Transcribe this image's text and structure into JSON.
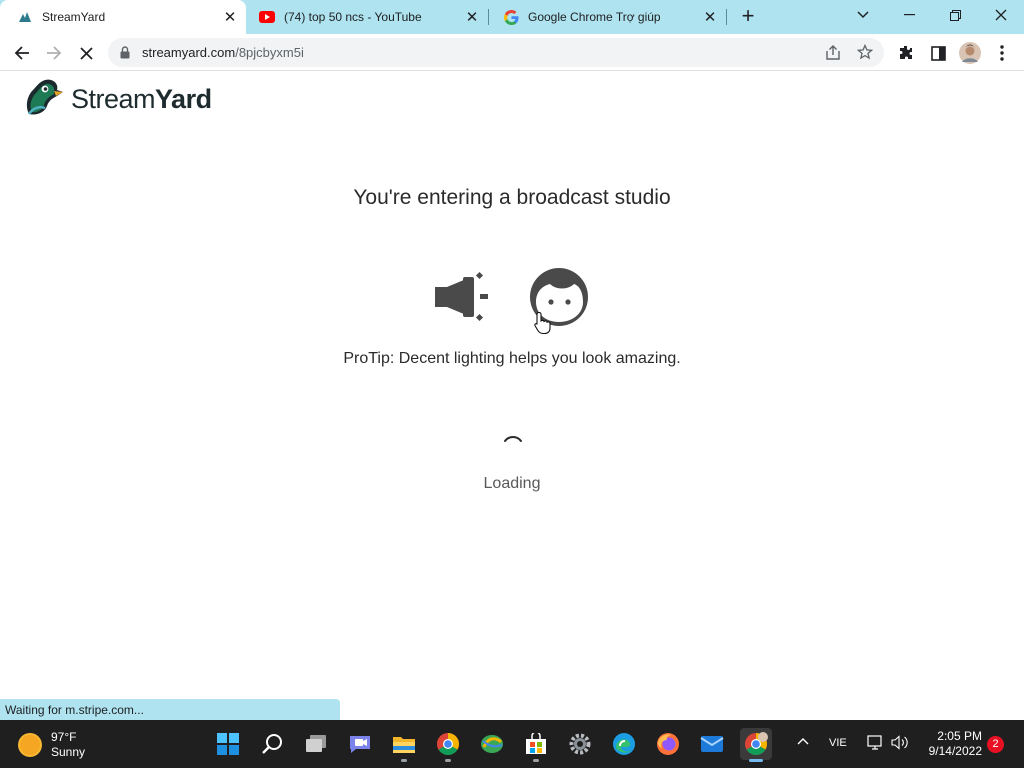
{
  "browser": {
    "tabs": [
      {
        "title": "StreamYard",
        "favicon": "streamyard-icon",
        "active": true
      },
      {
        "title": "(74) top 50 ncs - YouTube",
        "favicon": "youtube-icon",
        "active": false
      },
      {
        "title": "Google Chrome Trợ giúp",
        "favicon": "google-icon",
        "active": false
      }
    ],
    "url_host": "streamyard.com",
    "url_path": "/8pjcbyxm5i",
    "status_text": "Waiting for m.stripe.com..."
  },
  "page": {
    "logo_text_light": "Stream",
    "logo_text_bold": "Yard",
    "heading": "You're entering a broadcast studio",
    "protip": "ProTip: Decent lighting helps you look amazing.",
    "loading_text": "Loading"
  },
  "taskbar": {
    "weather_temp": "97°F",
    "weather_desc": "Sunny",
    "language": "VIE",
    "time": "2:05 PM",
    "date": "9/14/2022",
    "notification_count": "2",
    "apps": [
      "windows-start-icon",
      "search-icon",
      "task-view-icon",
      "teams-chat-icon",
      "file-explorer-icon",
      "chrome-icon",
      "app-icon",
      "microsoft-store-icon",
      "settings-icon",
      "edge-icon",
      "firefox-icon",
      "mail-icon",
      "chrome-profile-icon"
    ]
  },
  "colors": {
    "tab_strip": "#aee3ef",
    "taskbar": "#1f1f1f",
    "icon_gray": "#4a4a4a"
  }
}
